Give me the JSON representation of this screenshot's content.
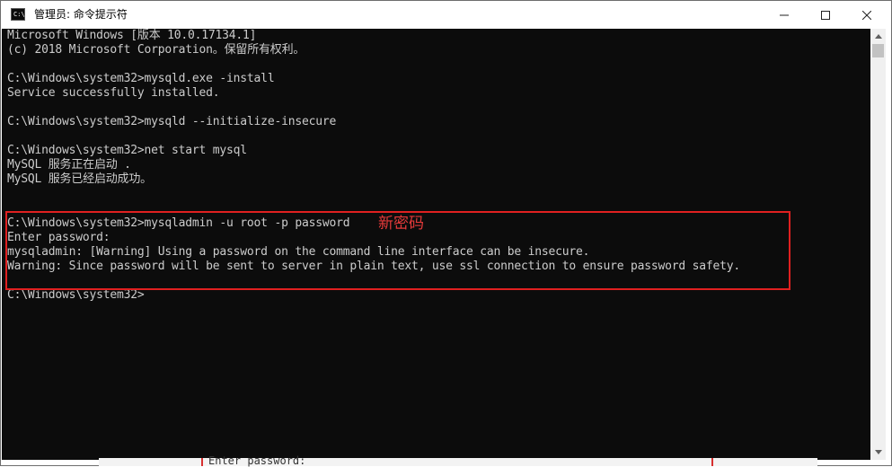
{
  "window": {
    "title": "管理员: 命令提示符",
    "icon_label": "C:\\"
  },
  "console": {
    "lines": [
      "Microsoft Windows [版本 10.0.17134.1]",
      "(c) 2018 Microsoft Corporation。保留所有权利。",
      "",
      "C:\\Windows\\system32>mysqld.exe -install",
      "Service successfully installed.",
      "",
      "C:\\Windows\\system32>mysqld --initialize-insecure",
      "",
      "C:\\Windows\\system32>net start mysql",
      "MySQL 服务正在启动 .",
      "MySQL 服务已经启动成功。",
      "",
      "",
      "C:\\Windows\\system32>mysqladmin -u root -p password",
      "Enter password:",
      "mysqladmin: [Warning] Using a password on the command line interface can be insecure.",
      "Warning: Since password will be sent to server in plain text, use ssl connection to ensure password safety.",
      "",
      "C:\\Windows\\system32>"
    ]
  },
  "annotation": {
    "text": "新密码",
    "color": "#e53a3a"
  },
  "background_window": {
    "text": "Enter password:"
  },
  "colors": {
    "console_bg": "#0c0c0c",
    "console_text": "#cccccc",
    "highlight": "#e02020"
  },
  "icons": [
    "cmd-app-icon",
    "minimize-icon",
    "maximize-icon",
    "close-icon",
    "scroll-up-arrow-icon",
    "scroll-down-arrow-icon"
  ]
}
